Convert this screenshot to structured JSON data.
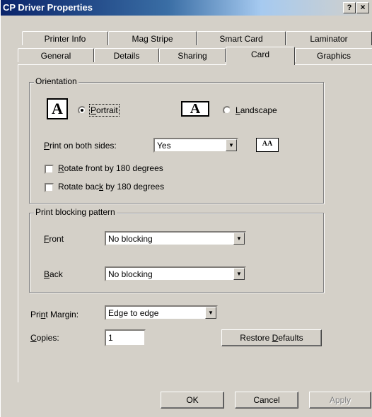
{
  "window": {
    "title": "CP Driver Properties",
    "help": "?",
    "close": "×"
  },
  "tabs": {
    "row1": [
      "Printer Info",
      "Mag Stripe",
      "Smart Card",
      "Laminator"
    ],
    "row2": [
      "General",
      "Details",
      "Sharing",
      "Card",
      "Graphics"
    ],
    "active": "Card"
  },
  "orientation": {
    "legend": "Orientation",
    "icon_letter": "A",
    "portrait": {
      "label_u": "P",
      "label_rest": "ortrait",
      "selected": true
    },
    "landscape": {
      "label_u": "L",
      "label_rest": "andscape",
      "selected": false
    },
    "both_sides": {
      "label_pre": "",
      "label_u": "P",
      "label_rest": "rint on both sides:",
      "value": "Yes"
    },
    "both_sides_icon": "AA",
    "rotate_front": {
      "label_pre": "",
      "label_u": "R",
      "label_rest": "otate front by 180 degrees",
      "checked": false
    },
    "rotate_back": {
      "label_pre": "Rotate bac",
      "label_u": "k",
      "label_rest": " by 180 degrees",
      "checked": false
    }
  },
  "blocking": {
    "legend": "Print blocking pattern",
    "front": {
      "label_u": "F",
      "label_rest": "ront",
      "value": "No blocking"
    },
    "back": {
      "label_u": "B",
      "label_rest": "ack",
      "value": "No blocking"
    }
  },
  "margin": {
    "label_pre": "Pri",
    "label_u": "n",
    "label_rest": "t Margin:",
    "value": "Edge to edge"
  },
  "copies": {
    "label_u": "C",
    "label_rest": "opies:",
    "value": "1"
  },
  "restore": {
    "label_pre": "Restore ",
    "label_u": "D",
    "label_rest": "efaults"
  },
  "buttons": {
    "ok": "OK",
    "cancel": "Cancel",
    "apply": "Apply"
  }
}
